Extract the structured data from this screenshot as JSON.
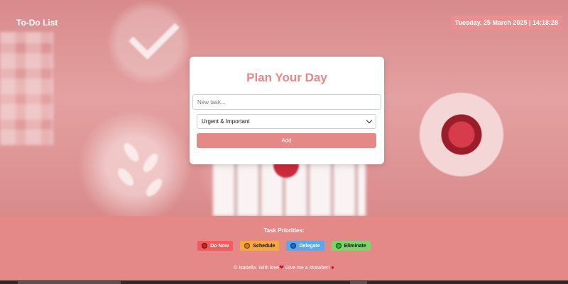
{
  "header": {
    "app_title": "To-Do List",
    "datetime": "Tuesday, 25 March 2025 | 14:18:28"
  },
  "card": {
    "title": "Plan Your Day",
    "task_placeholder": "New task...",
    "priority_selected": "Urgent & Important",
    "add_label": "Add"
  },
  "legend": {
    "title": "Task Priorities:",
    "items": [
      {
        "label": "Do Now",
        "bg": "#f25c5c",
        "dot": "#d61f1f",
        "text_color": "#ffffff"
      },
      {
        "label": "Schedule",
        "bg": "#f5a93a",
        "dot": "#e57a1a",
        "text_color": "#111111"
      },
      {
        "label": "Delegate",
        "bg": "#57a8f2",
        "dot": "#2067c9",
        "text_color": "#ffffff"
      },
      {
        "label": "Eliminate",
        "bg": "#7fd36b",
        "dot": "#2fb52a",
        "text_color": "#111111"
      }
    ]
  },
  "footer": {
    "credit_prefix": "© Isabella. With love",
    "credit_link": "Give me a strawberi",
    "heart_icon": "heart-icon",
    "strawberry_icon": "strawberry-icon"
  },
  "colors": {
    "accent": "#e58888",
    "clock_bg": "#ea8f90"
  }
}
